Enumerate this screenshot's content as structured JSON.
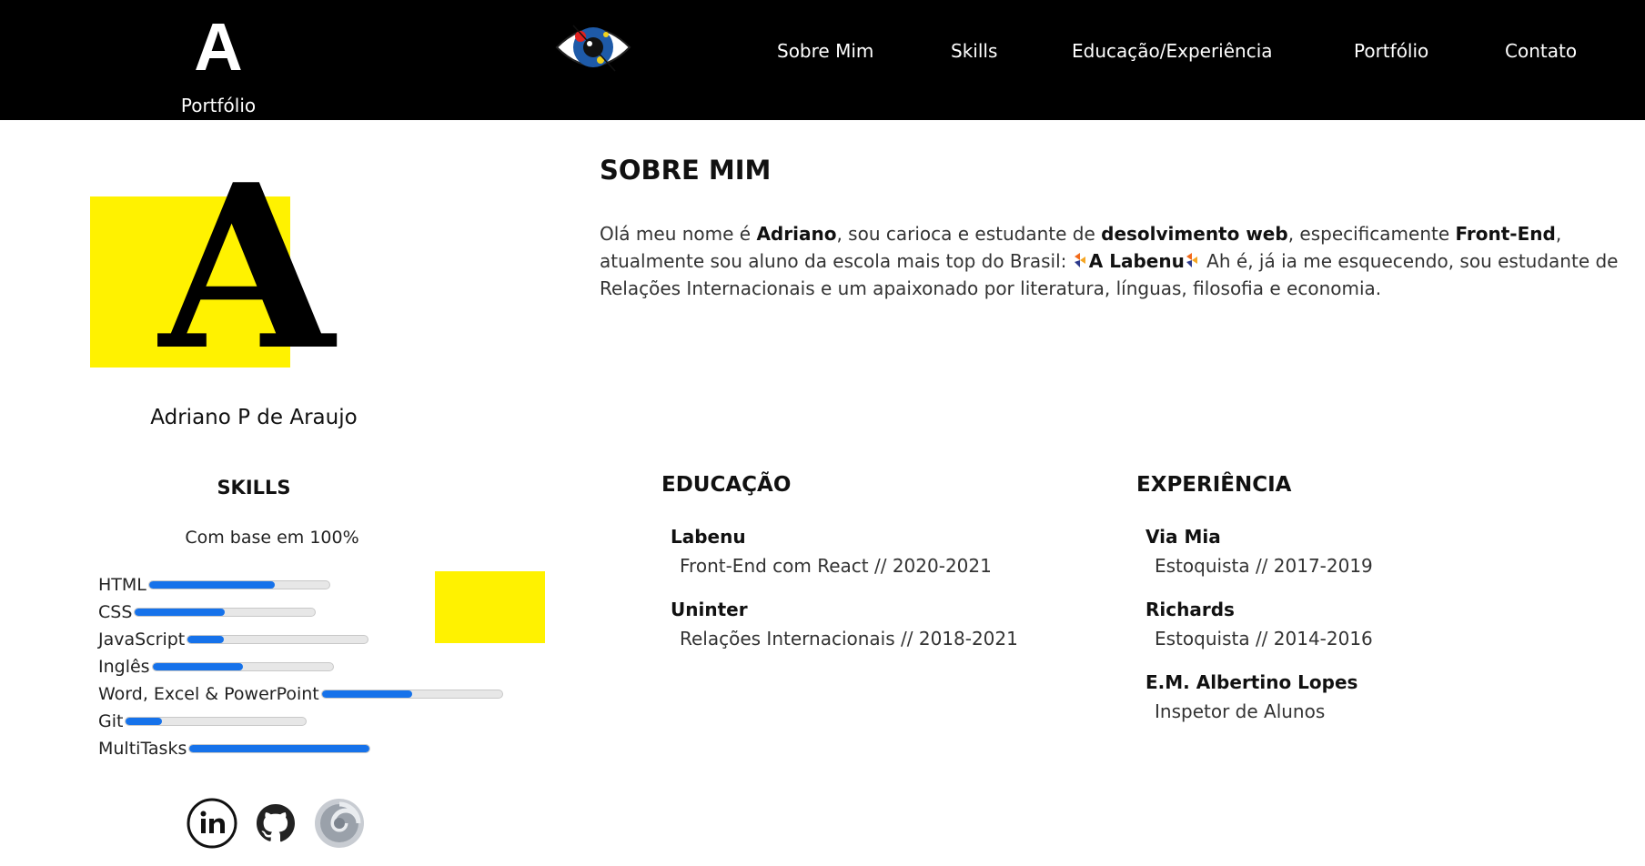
{
  "nav": {
    "brand_letter": "A",
    "brand_sub": "Portfólio",
    "links": [
      "Sobre Mim",
      "Skills",
      "Educação/Experiência",
      "Portfólio",
      "Contato"
    ]
  },
  "profile": {
    "avatar_letter": "A",
    "name": "Adriano P de Araujo"
  },
  "skills": {
    "title": "SKILLS",
    "note": "Com base em 100%",
    "items": [
      {
        "label": "HTML",
        "level": 0.7
      },
      {
        "label": "CSS",
        "level": 0.5
      },
      {
        "label": "JavaScript",
        "level": 0.2
      },
      {
        "label": "Inglês",
        "level": 0.5
      },
      {
        "label": "Word, Excel & PowerPoint",
        "level": 0.5
      },
      {
        "label": "Git",
        "level": 0.2
      },
      {
        "label": "MultiTasks",
        "level": 1.0
      }
    ]
  },
  "about": {
    "title": "SOBRE MIM",
    "p1": "Olá meu nome é ",
    "b1": "Adriano",
    "p2": ", sou carioca e estudante de ",
    "b2": "desolvimento web",
    "p3": ", especificamente ",
    "b3": "Front-End",
    "p4": ", atualmente sou aluno da escola mais top do Brasil: ",
    "b4": "A Labenu",
    "p5": " Ah é, já ia me esquecendo, sou estudante de Relações Internacionais e um apaixonado por literatura, línguas, filosofia e economia."
  },
  "education": {
    "title": "EDUCAÇÃO",
    "entries": [
      {
        "name": "Labenu",
        "detail": "Front-End com React // 2020-2021"
      },
      {
        "name": "Uninter",
        "detail": "Relações Internacionais // 2018-2021"
      }
    ]
  },
  "experience": {
    "title": "EXPERIÊNCIA",
    "entries": [
      {
        "name": "Via Mia",
        "detail": "Estoquista // 2017-2019"
      },
      {
        "name": "Richards",
        "detail": "Estoquista // 2014-2016"
      },
      {
        "name": "E.M. Albertino Lopes",
        "detail": "Inspetor de Alunos"
      }
    ]
  },
  "colors": {
    "nav_bg": "#000000",
    "accent_yellow": "#fff200",
    "bar_fill": "#1672ea"
  },
  "icons": [
    "eye-logo-icon",
    "labenu-icon",
    "linkedin-icon",
    "github-icon",
    "portfolio-swirl-icon"
  ]
}
